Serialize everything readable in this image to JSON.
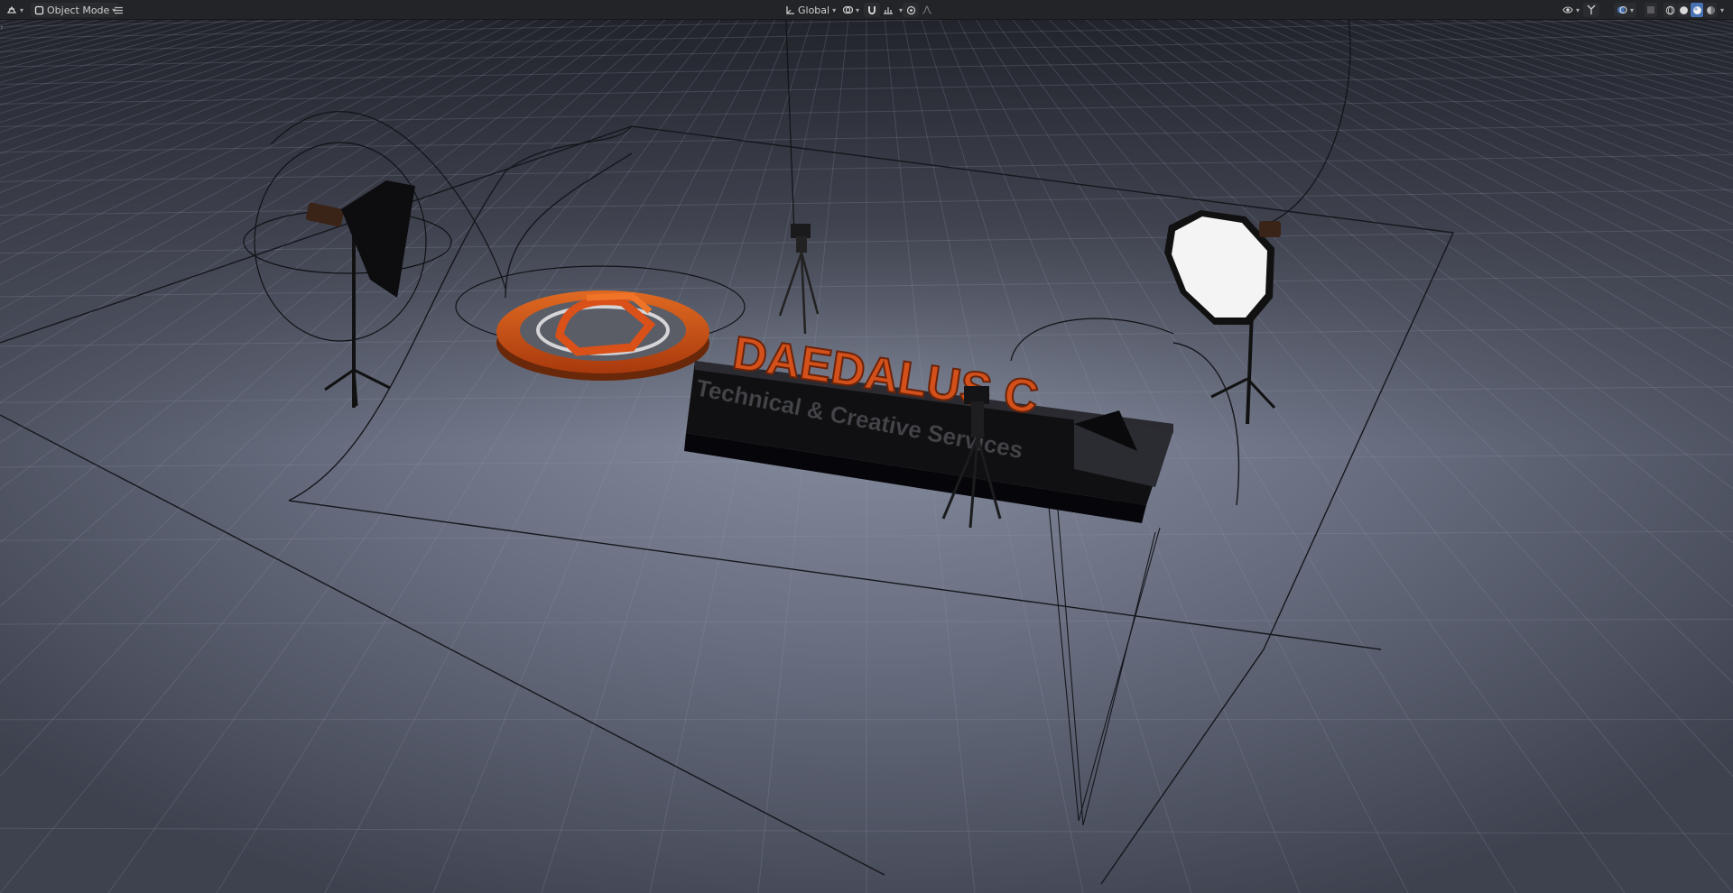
{
  "header": {
    "editor_type_icon": "3d-viewport-icon",
    "mode_label": "Object Mode",
    "transform_orientation_label": "Global",
    "pivot_icon": "pivot-point-icon",
    "snap_icon": "snap-magnet-icon",
    "snap_target_label": "",
    "proportional_icon": "proportional-editing-icon",
    "visibility_icon": "object-visibility-icon",
    "gizmo_icon": "gizmo-icon",
    "overlay_icon": "overlays-icon",
    "xray_icon": "xray-icon",
    "shading_modes": [
      "wireframe",
      "solid",
      "material-preview",
      "rendered"
    ],
    "active_shading": "material-preview"
  },
  "scene": {
    "logo_text": "DAEDALUS C",
    "tagline_text": "Technical & Creative Services",
    "colors": {
      "background_top": "#25272f",
      "background_mid": "#5d6272",
      "floor_light": "#7e8596",
      "logo_orange": "#cf4f15",
      "logo_dark": "#1f1f22",
      "accent_blue": "#4772b3"
    }
  }
}
